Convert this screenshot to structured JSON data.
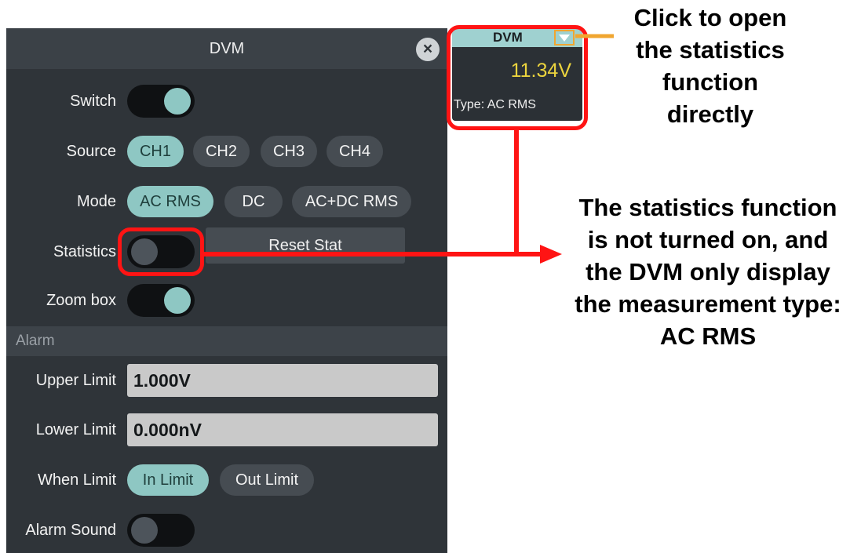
{
  "dvm_panel": {
    "title": "DVM",
    "close_symbol": "×",
    "switch": {
      "label": "Switch",
      "on": true
    },
    "source": {
      "label": "Source",
      "options": [
        "CH1",
        "CH2",
        "CH3",
        "CH4"
      ],
      "selected": "CH1"
    },
    "mode": {
      "label": "Mode",
      "options": [
        "AC RMS",
        "DC",
        "AC+DC RMS"
      ],
      "selected": "AC RMS"
    },
    "statistics": {
      "label": "Statistics",
      "on": false,
      "reset_label": "Reset Stat"
    },
    "zoom_box": {
      "label": "Zoom box",
      "on": true
    },
    "alarm_section": "Alarm",
    "upper_limit": {
      "label": "Upper Limit",
      "value": "1.000V"
    },
    "lower_limit": {
      "label": "Lower Limit",
      "value": "0.000nV"
    },
    "when_limit": {
      "label": "When Limit",
      "options": [
        "In Limit",
        "Out Limit"
      ],
      "selected": "In Limit"
    },
    "alarm_sound": {
      "label": "Alarm Sound",
      "on": false
    }
  },
  "dvm_widget": {
    "title": "DVM",
    "value": "11.34V",
    "type_text": "Type: AC RMS",
    "dropdown_icon": "triangle-down-icon"
  },
  "annotations": {
    "top_lines": [
      "Click to open",
      "the statistics",
      "function",
      "directly"
    ],
    "middle_lines": [
      "The statistics function",
      "is not turned on, and",
      "the DVM only display",
      "the measurement type:",
      "AC RMS"
    ]
  },
  "colors": {
    "accent": "#8ec7c3",
    "panel_bg": "#2f3439",
    "highlight": "#ff1414",
    "orange_marker": "#f0a630",
    "value_yellow": "#ecd43e"
  }
}
